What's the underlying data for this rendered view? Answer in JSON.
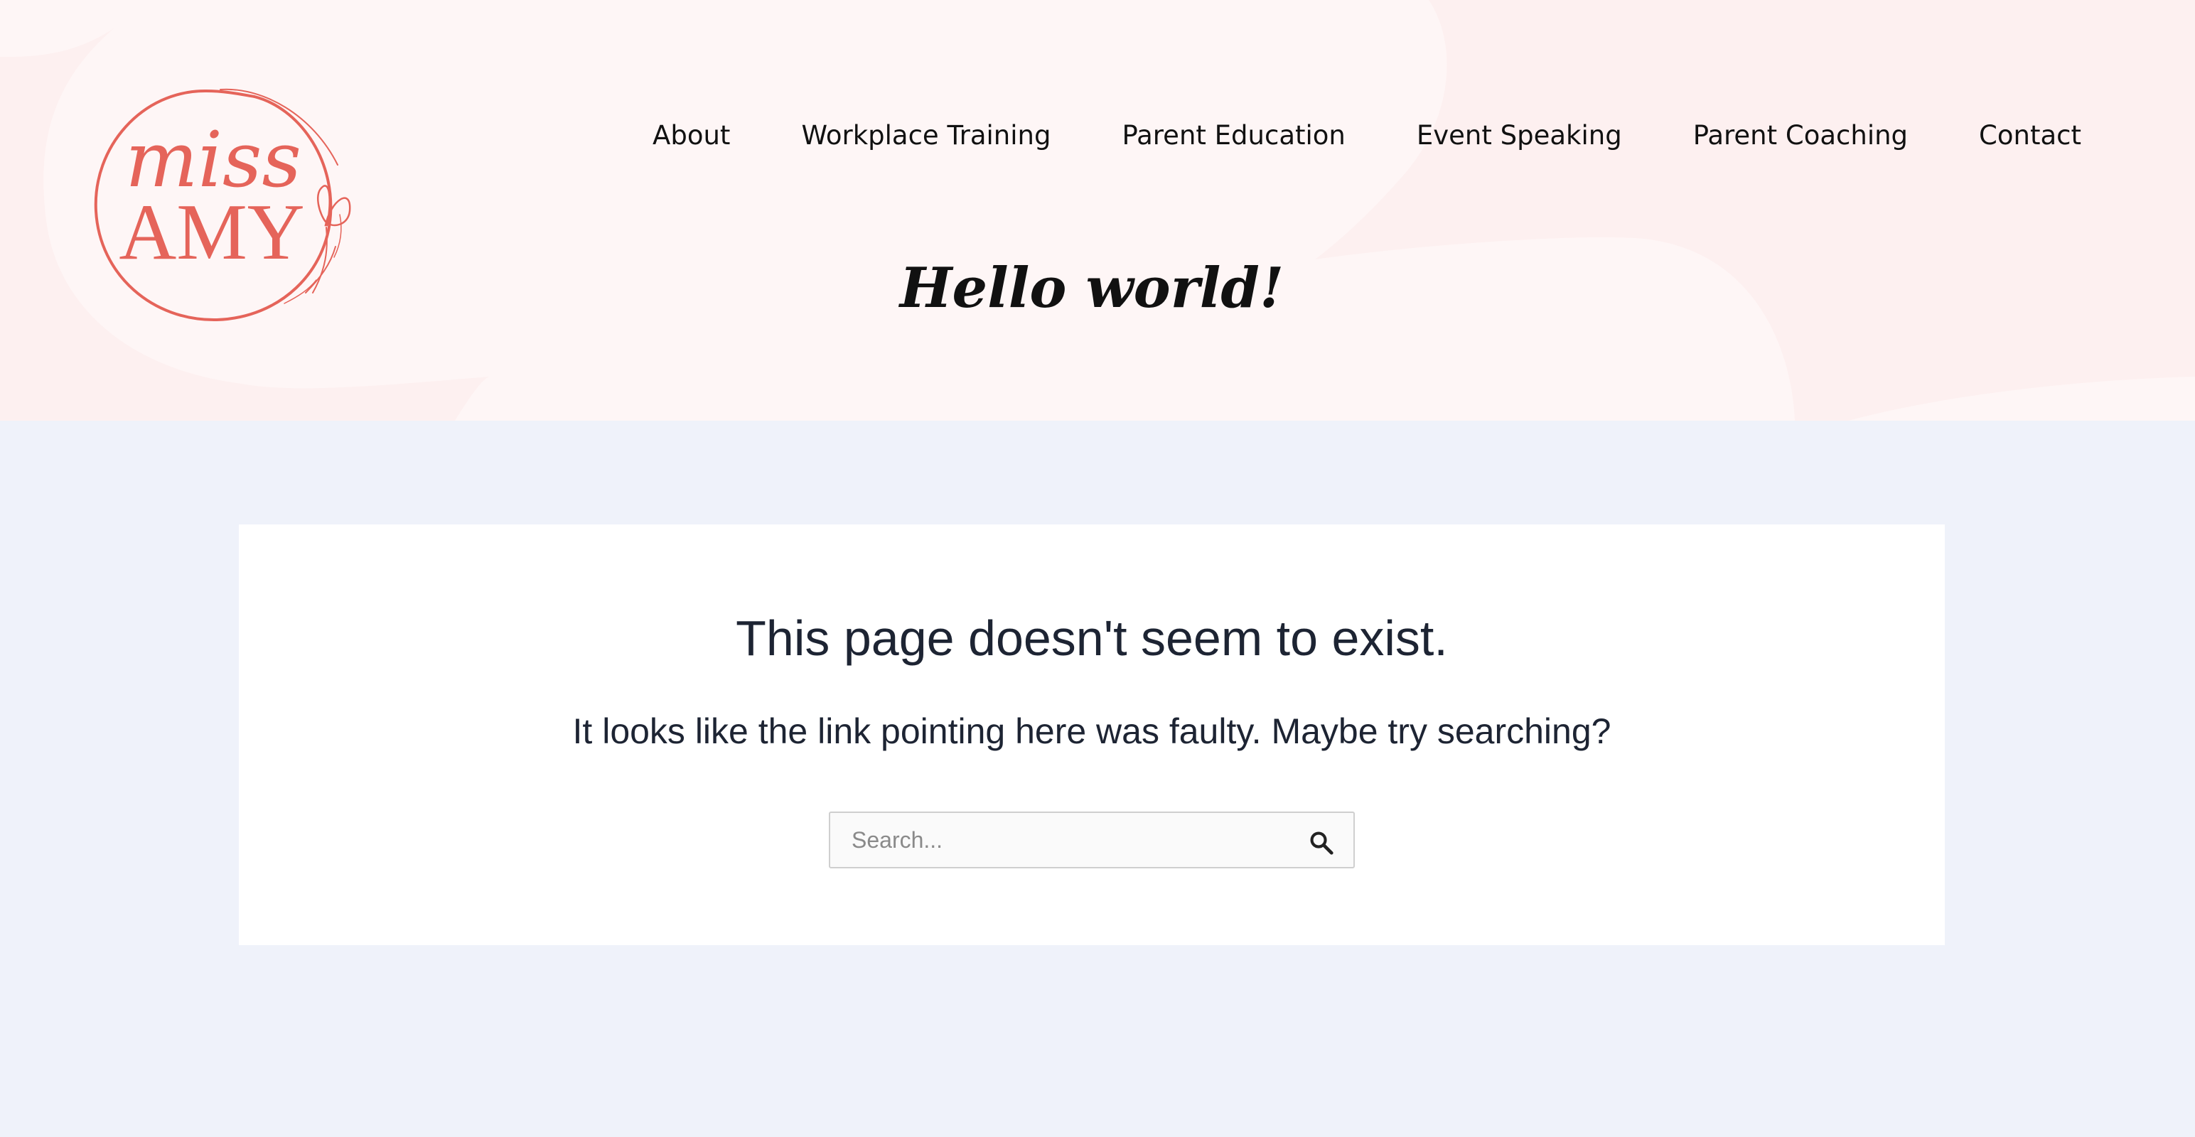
{
  "brand": {
    "logo_top": "miss",
    "logo_bottom": "AMY",
    "logo_color": "#e5645a"
  },
  "nav": {
    "items": [
      {
        "label": "About"
      },
      {
        "label": "Workplace Training"
      },
      {
        "label": "Parent Education"
      },
      {
        "label": "Event Speaking"
      },
      {
        "label": "Parent Coaching"
      },
      {
        "label": "Contact"
      }
    ]
  },
  "header": {
    "title": "Hello world!"
  },
  "error": {
    "title": "This page doesn't seem to exist.",
    "message": "It looks like the link pointing here was faulty. Maybe try searching?"
  },
  "search": {
    "placeholder": "Search...",
    "value": "",
    "button_icon": "search-icon"
  },
  "colors": {
    "header_background": "#fdf0f0",
    "page_background": "#eff2fa",
    "card_background": "#ffffff",
    "text_dark": "#1d2433"
  }
}
